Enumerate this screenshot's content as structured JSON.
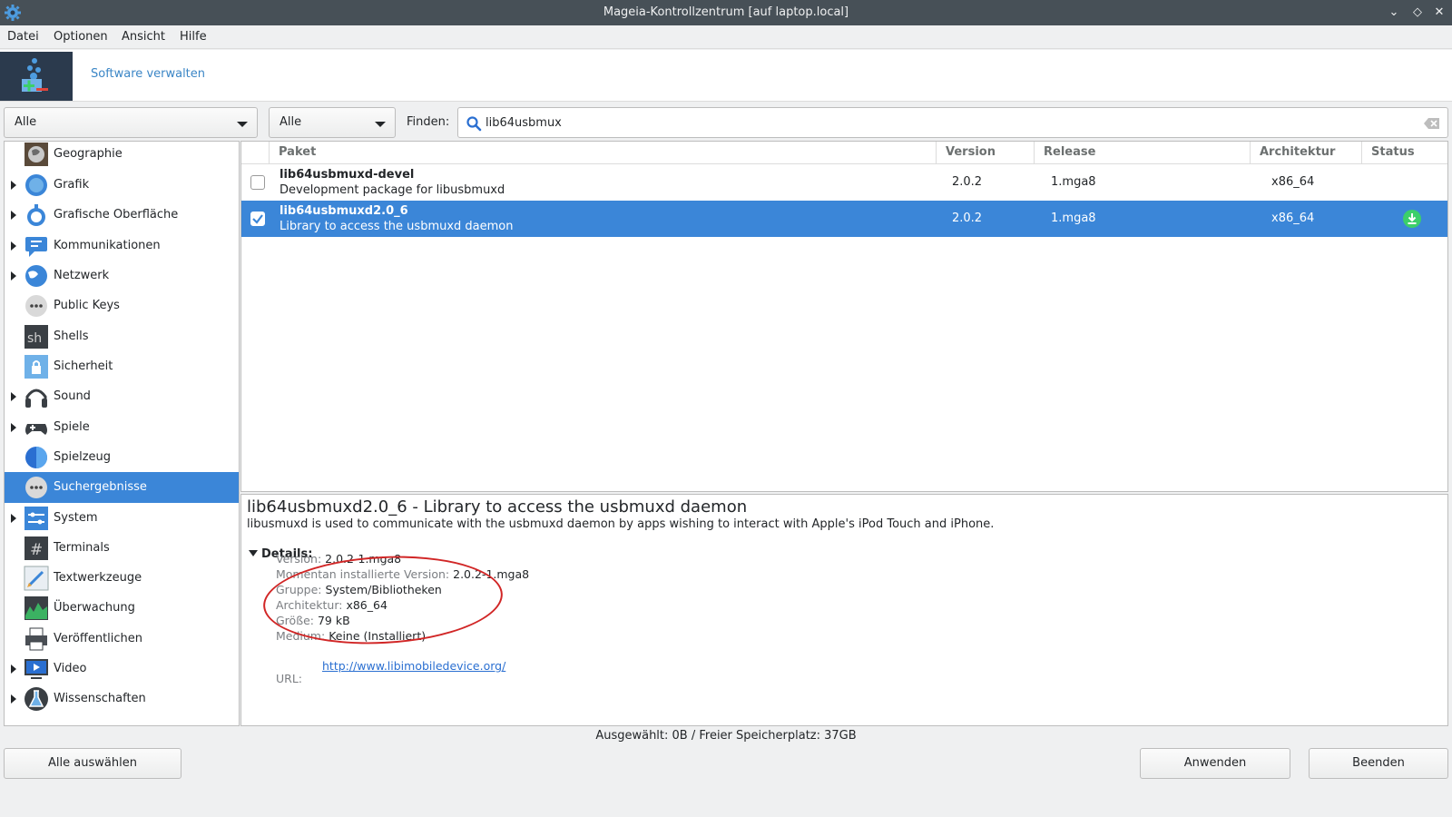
{
  "window": {
    "title": "Mageia-Kontrollzentrum [auf laptop.local]",
    "controls": [
      "⌄",
      "◇",
      "✕"
    ]
  },
  "menu": [
    {
      "label": "Datei"
    },
    {
      "label": "Optionen"
    },
    {
      "label": "Ansicht"
    },
    {
      "label": "Hilfe"
    }
  ],
  "banner": {
    "title": "Software verwalten"
  },
  "filters": {
    "combo1": "Alle",
    "combo2": "Alle",
    "find_label": "Finden:",
    "search_value": "lib64usbmux"
  },
  "categories": [
    {
      "label": "Geographie",
      "icon": "globe-map-icon",
      "expandable": false
    },
    {
      "label": "Grafik",
      "icon": "graphics-icon",
      "expandable": true
    },
    {
      "label": "Grafische Oberfläche",
      "icon": "desktop-gui-icon",
      "expandable": true
    },
    {
      "label": "Kommunikationen",
      "icon": "communications-icon",
      "expandable": true
    },
    {
      "label": "Netzwerk",
      "icon": "network-globe-icon",
      "expandable": true
    },
    {
      "label": "Public Keys",
      "icon": "more-dots-icon",
      "expandable": false
    },
    {
      "label": "Shells",
      "icon": "shell-icon",
      "expandable": false
    },
    {
      "label": "Sicherheit",
      "icon": "lock-icon",
      "expandable": false
    },
    {
      "label": "Sound",
      "icon": "headphones-icon",
      "expandable": true
    },
    {
      "label": "Spiele",
      "icon": "gamepad-icon",
      "expandable": true
    },
    {
      "label": "Spielzeug",
      "icon": "toy-icon",
      "expandable": false
    },
    {
      "label": "Suchergebnisse",
      "icon": "more-dots-icon",
      "expandable": false,
      "selected": true
    },
    {
      "label": "System",
      "icon": "system-settings-icon",
      "expandable": true
    },
    {
      "label": "Terminals",
      "icon": "terminal-hash-icon",
      "expandable": false
    },
    {
      "label": "Textwerkzeuge",
      "icon": "text-edit-icon",
      "expandable": false
    },
    {
      "label": "Überwachung",
      "icon": "monitoring-chart-icon",
      "expandable": false
    },
    {
      "label": "Veröffentlichen",
      "icon": "printer-icon",
      "expandable": false
    },
    {
      "label": "Video",
      "icon": "video-monitor-icon",
      "expandable": true
    },
    {
      "label": "Wissenschaften",
      "icon": "science-flask-icon",
      "expandable": true
    }
  ],
  "table": {
    "columns": [
      "Paket",
      "Version",
      "Release",
      "Architektur",
      "Status"
    ],
    "rows": [
      {
        "name": "lib64usbmuxd-devel",
        "summary": "Development package for libusbmuxd",
        "version": "2.0.2",
        "release": "1.mga8",
        "arch": "x86_64",
        "checked": false,
        "selected": false,
        "status": ""
      },
      {
        "name": "lib64usbmuxd2.0_6",
        "summary": "Library to access the usbmuxd daemon",
        "version": "2.0.2",
        "release": "1.mga8",
        "arch": "x86_64",
        "checked": true,
        "selected": true,
        "status": "installed-download-icon"
      }
    ]
  },
  "details": {
    "title": "lib64usbmuxd2.0_6 - Library to access the usbmuxd daemon",
    "description": "libusmuxd is used to communicate with the usbmuxd daemon by apps wishing to interact with Apple's iPod Touch and iPhone.",
    "heading": "Details:",
    "fields": [
      {
        "key": "Version:",
        "value": "2.0.2-1.mga8"
      },
      {
        "key": "Momentan installierte Version:",
        "value": "2.0.2-1.mga8"
      },
      {
        "key": "Gruppe:",
        "value": "System/Bibliotheken"
      },
      {
        "key": "Architektur:",
        "value": "x86_64"
      },
      {
        "key": "Größe:",
        "value": "79 kB"
      },
      {
        "key": "Medium:",
        "value": "Keine (Installiert)"
      }
    ],
    "url_key": "URL:",
    "url": "http://www.libimobiledevice.org/"
  },
  "status_text": "Ausgewählt: 0B / Freier Speicherplatz: 37GB",
  "buttons": {
    "select_all": "Alle auswählen",
    "apply": "Anwenden",
    "quit": "Beenden"
  },
  "colors": {
    "selection": "#3b86d8",
    "titlebar": "#475057",
    "link": "#2a6fd1",
    "annotation_circle": "#d12626",
    "status_ok": "#3ccf6a"
  }
}
